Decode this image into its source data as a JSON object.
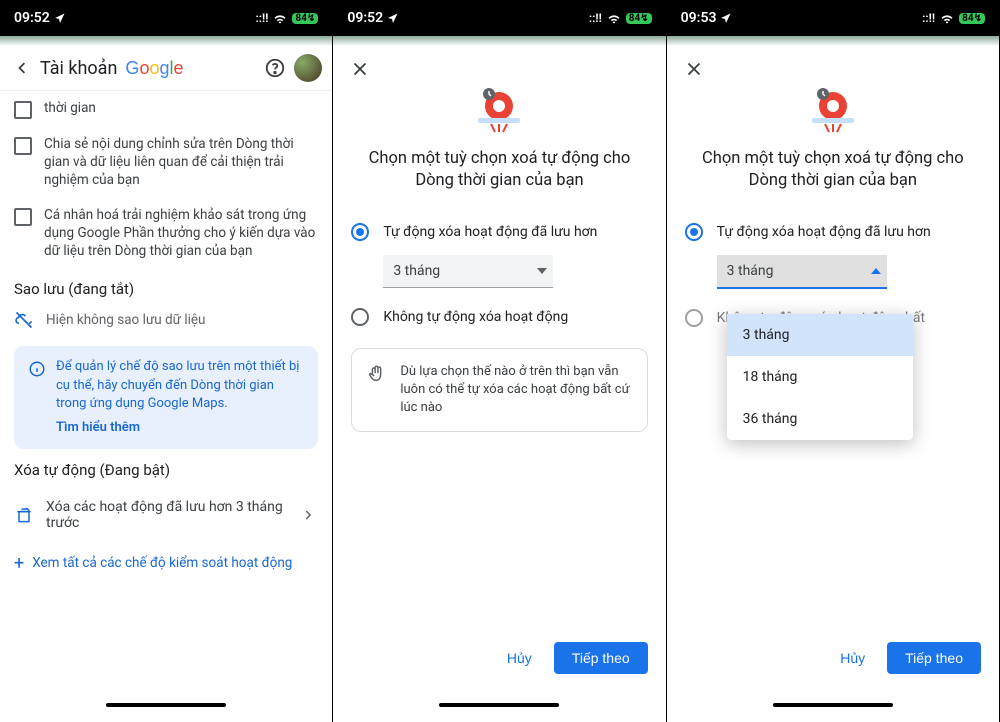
{
  "statusbar": {
    "time1": "09:52",
    "time2": "09:52",
    "time3": "09:53",
    "signal": "::!!",
    "battery": "84"
  },
  "panel1": {
    "header_title": "Tài khoản",
    "chk1_partial": "thời gian",
    "chk2": "Chia sẻ nội dung chỉnh sửa trên Dòng thời gian và dữ liệu liên quan để cải thiện trải nghiệm của bạn",
    "chk3": "Cá nhân hoá trải nghiệm khảo sát trong ứng dụng Google Phần thưởng cho ý kiến dựa vào dữ liệu trên Dòng thời gian của bạn",
    "backup_heading": "Sao lưu (đang tắt)",
    "backup_status": "Hiện không sao lưu dữ liệu",
    "info_text": "Để quản lý chế độ sao lưu trên một thiết bị cụ thể, hãy chuyển đến Dòng thời gian trong ứng dụng Google Maps.",
    "info_link": "Tìm hiểu thêm",
    "autodel_heading": "Xóa tự động (Đang bật)",
    "autodel_row": "Xóa các hoạt động đã lưu hơn 3 tháng trước",
    "all_link": "Xem tất cả các chế độ kiểm soát hoạt động"
  },
  "dialog": {
    "title": "Chọn một tuỳ chọn xoá tự động cho Dòng thời gian của bạn",
    "opt_auto": "Tự động xóa hoạt động đã lưu hơn",
    "select_value": "3 tháng",
    "opt_off": "Không tự động xóa hoạt động",
    "opt_off_short": "Không tự động xóa hoạt động bất",
    "note": "Dù lựa chọn thế nào ở trên thì bạn vẫn luôn có thể tự xóa các hoạt động bất cứ lúc nào",
    "note_partial1": "bạn vẫn",
    "note_partial2": "ộng bất",
    "cancel": "Hủy",
    "next": "Tiếp theo",
    "dd_opt1": "3 tháng",
    "dd_opt2": "18 tháng",
    "dd_opt3": "36 tháng"
  }
}
